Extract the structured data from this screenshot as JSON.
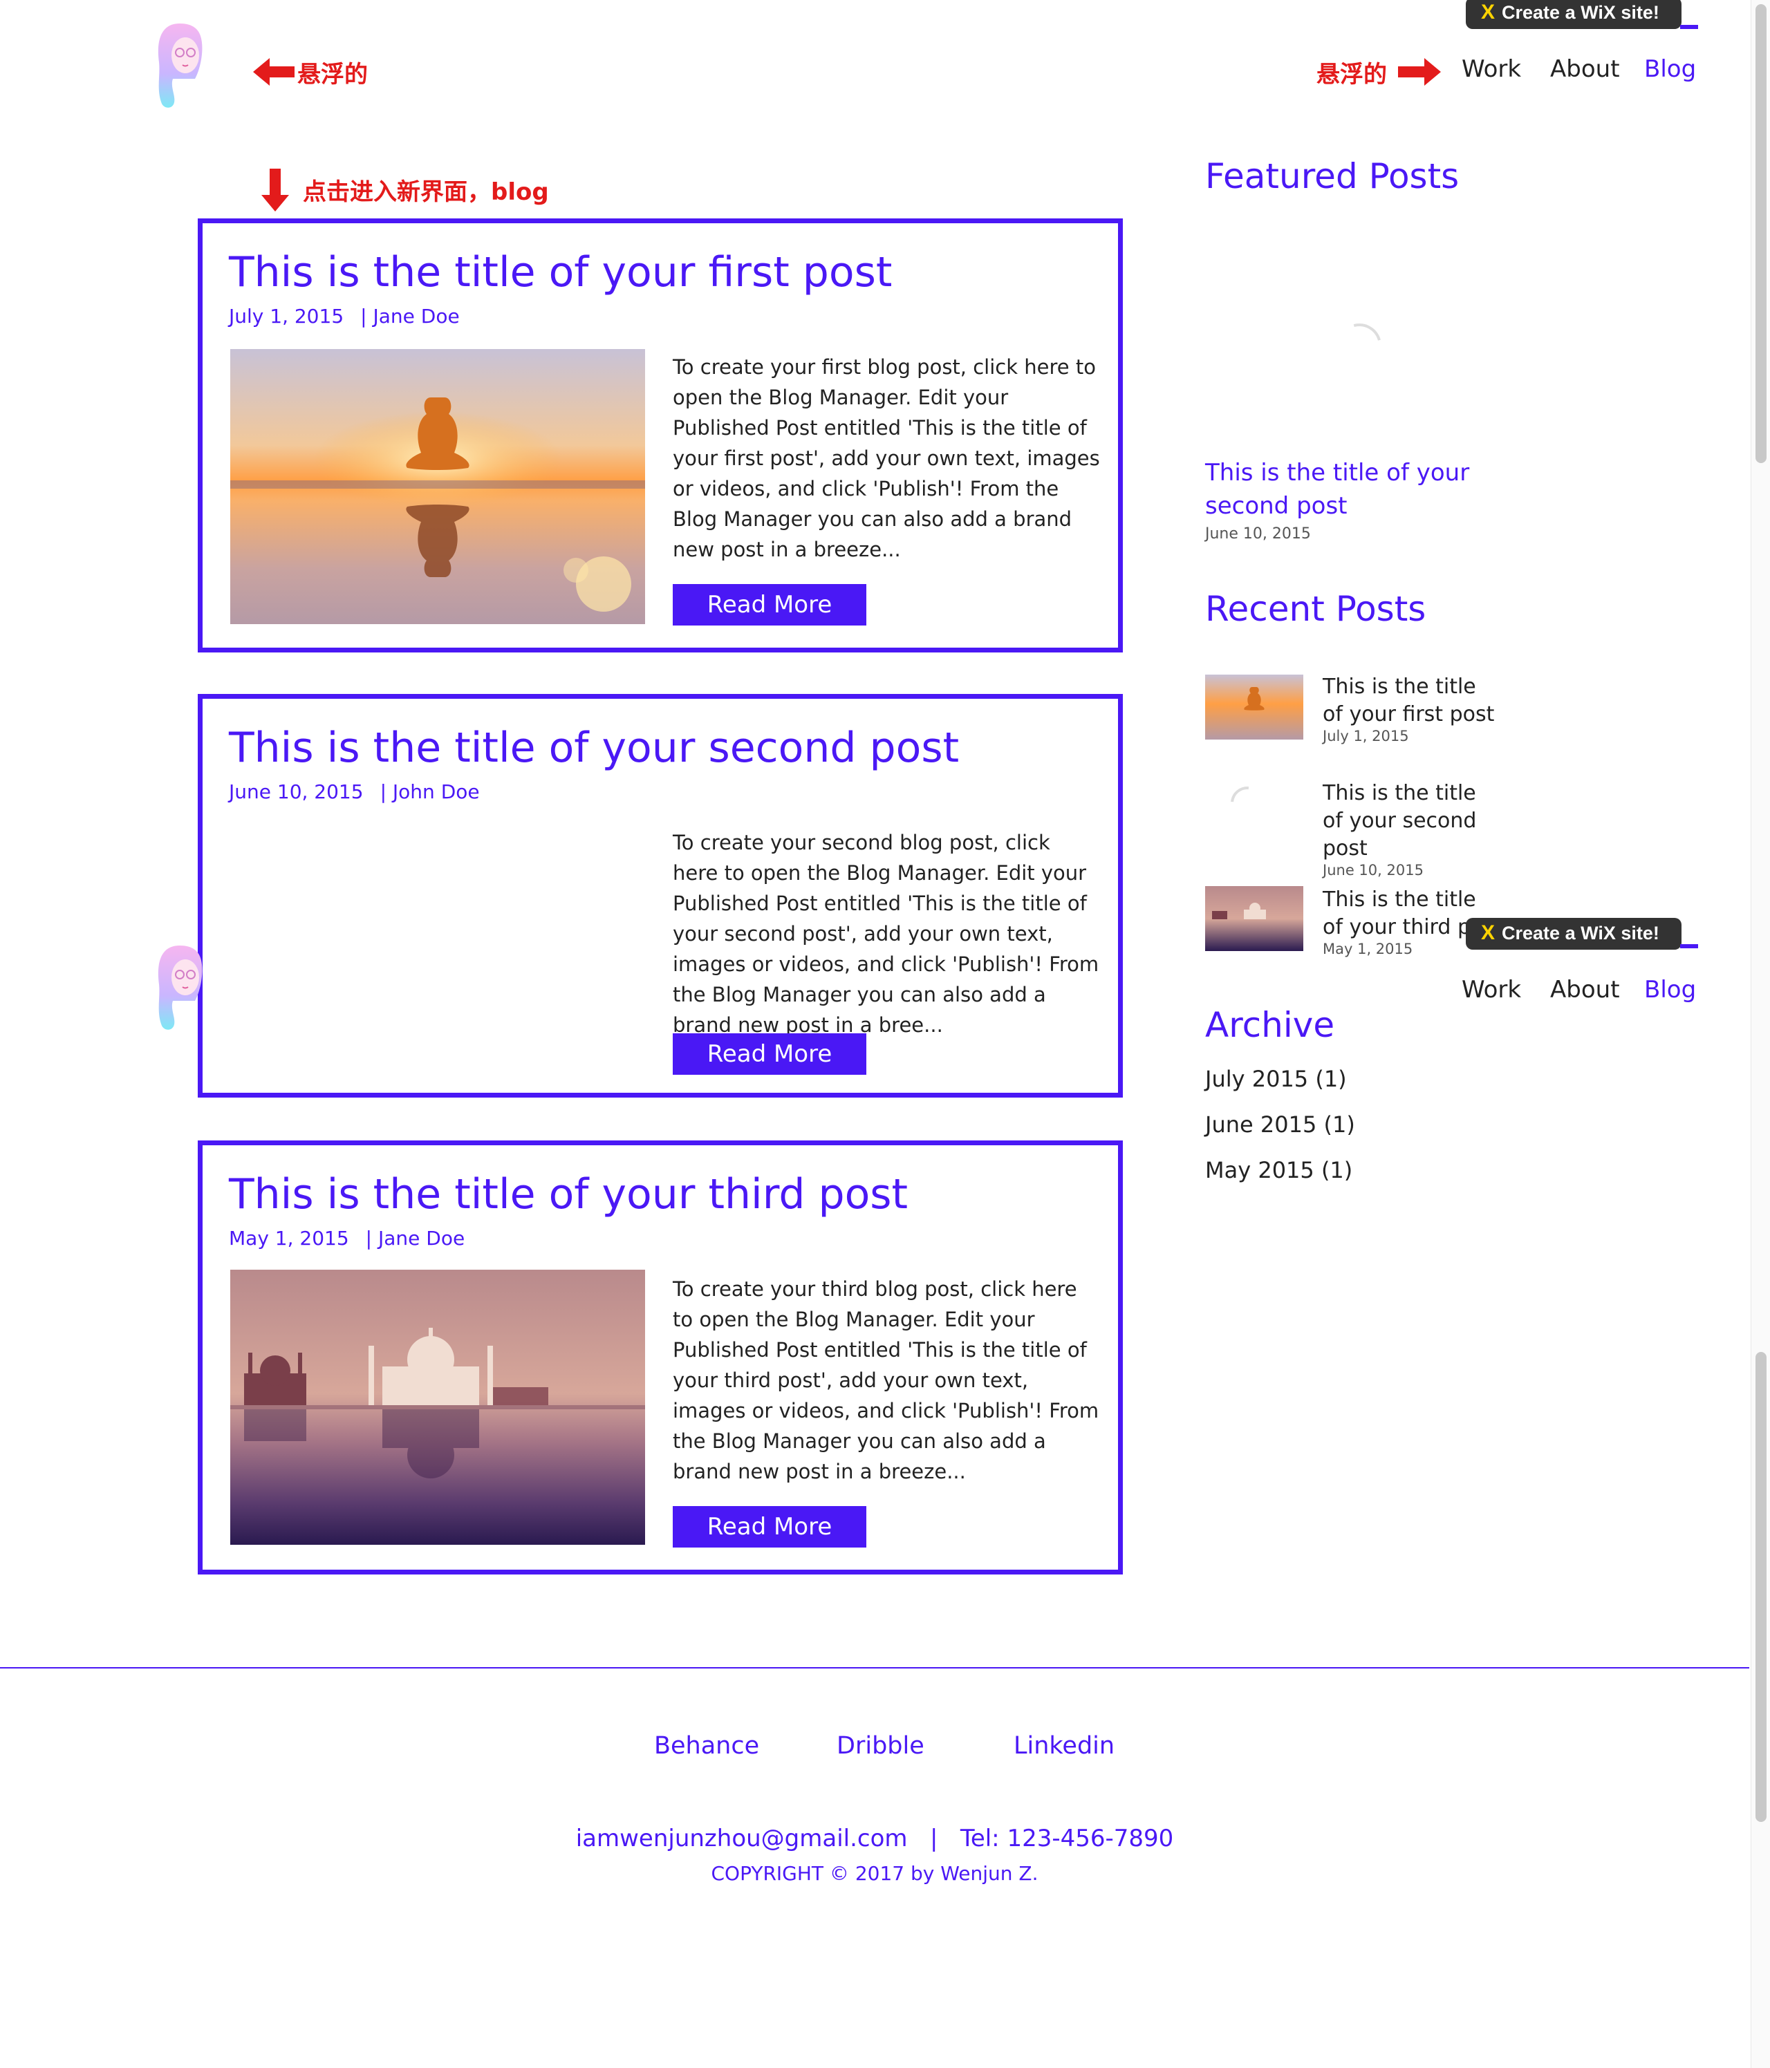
{
  "wix_banner": {
    "label": "Create a WiX site!",
    "logo": "X"
  },
  "nav": {
    "items": [
      "Work",
      "About",
      "Blog"
    ],
    "active": "Blog"
  },
  "annotations": {
    "hover_left": "悬浮的",
    "hover_right": "悬浮的",
    "click_blog": "点击进入新界面，blog"
  },
  "posts": [
    {
      "title": "This is the title of your first post",
      "date": "July 1, 2015",
      "author": "| Jane Doe",
      "excerpt": "To create your first blog post, click here to open the Blog Manager.  Edit your Published Post entitled 'This is the title of your first post', add your own text, images or videos, and click 'Publish'! From the Blog Manager you can also add a brand new post in a breeze...",
      "read_more": "Read More",
      "image": "meditation-sunset"
    },
    {
      "title": "This is the title of your second post",
      "date": "June 10, 2015",
      "author": "| John Doe",
      "excerpt": "To create your second blog post, click here to open the Blog Manager.  Edit your Published Post entitled 'This is the title of your second post', add your own text, images or videos, and click 'Publish'! From the Blog Manager you can also add a brand new post in a bree...",
      "read_more": "Read More",
      "image": "none"
    },
    {
      "title": "This is the title of your third post",
      "date": "May 1, 2015",
      "author": "| Jane Doe",
      "excerpt": "To create your third blog post, click here to open the Blog Manager.  Edit your Published Post entitled 'This is the title of your third post', add your own text, images or videos, and click 'Publish'! From the Blog Manager you can also add a brand new post in a breeze...",
      "read_more": "Read More",
      "image": "taj-mahal"
    }
  ],
  "sidebar": {
    "featured_heading": "Featured Posts",
    "featured_post": {
      "title": "This is the title of your second post",
      "date": "June 10, 2015"
    },
    "recent_heading": "Recent Posts",
    "recent_posts": [
      {
        "title": "This is the title of your first post",
        "date": "July 1, 2015"
      },
      {
        "title": "This is the title of your second post",
        "date": "June 10, 2015"
      },
      {
        "title": "This is the title of your third post",
        "date": "May 1, 2015"
      }
    ],
    "archive_heading": "Archive",
    "archive": [
      "July 2015 (1)",
      "June 2015 (1)",
      "May 2015 (1)"
    ]
  },
  "footer": {
    "links": [
      "Behance",
      "Dribble",
      "Linkedin"
    ],
    "contact": "iamwenjunzhou@gmail.com   |   Tel: 123-456-7890",
    "copyright": "COPYRIGHT © 2017 by Wenjun Z."
  },
  "colors": {
    "accent": "#4a18f5",
    "annotation": "#e31b1b",
    "banner": "#333333"
  }
}
